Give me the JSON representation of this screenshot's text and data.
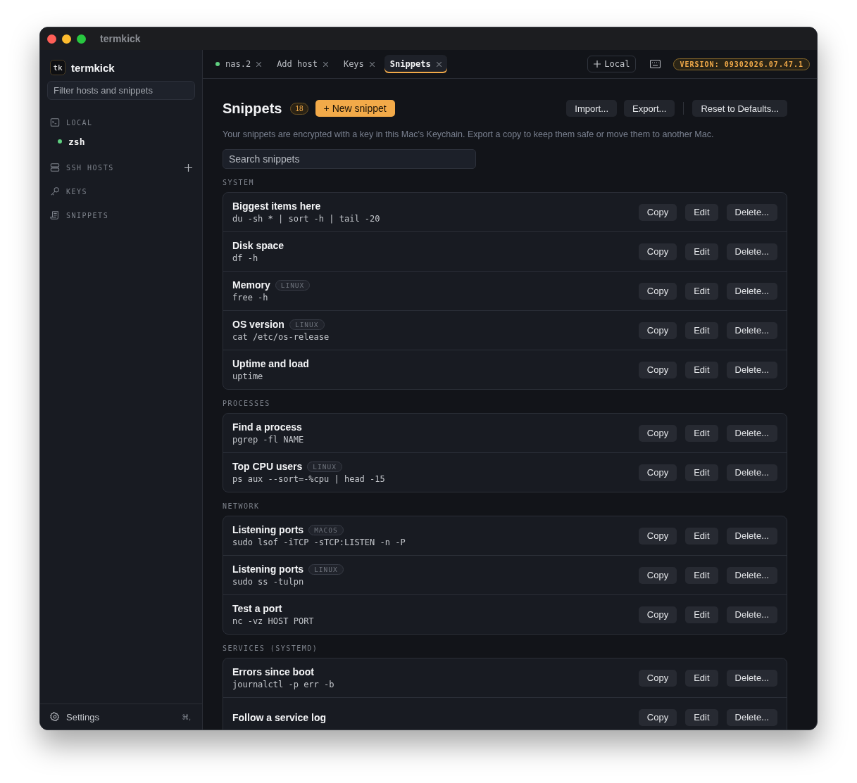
{
  "window": {
    "title": "termkick"
  },
  "sidebar": {
    "logo": "tk",
    "app_name": "termkick",
    "filter": {
      "placeholder": "Filter hosts and snippets"
    },
    "sections": [
      {
        "kind": "terminal",
        "label": "LOCAL",
        "add": false,
        "items": [
          {
            "label": "zsh",
            "color": "#5fcf80"
          }
        ]
      },
      {
        "kind": "server",
        "label": "SSH HOSTS",
        "add": true
      },
      {
        "kind": "key",
        "label": "KEYS",
        "add": false
      },
      {
        "kind": "scroll",
        "label": "SNIPPETS",
        "add": false
      }
    ],
    "settings": {
      "label": "Settings",
      "shortcut": "⌘,"
    }
  },
  "tabs": [
    {
      "label": "nas.2",
      "dot": true,
      "selected": false
    },
    {
      "label": "Add host",
      "dot": false,
      "selected": false
    },
    {
      "label": "Keys",
      "dot": false,
      "selected": false
    },
    {
      "label": "Snippets",
      "dot": false,
      "selected": true
    }
  ],
  "toolbar": {
    "local_button": "Local",
    "version": "VERSION: 09302026.07.47.1"
  },
  "page": {
    "title": "Snippets",
    "count": "18",
    "new_button": "+ New snippet",
    "actions": [
      "Import...",
      "Export...",
      "Reset to Defaults..."
    ],
    "description": "Your snippets are encrypted with a key in this Mac's Keychain. Export a copy to keep them safe or move them to another Mac.",
    "search": {
      "placeholder": "Search snippets"
    },
    "groups": [
      {
        "label": "SYSTEM",
        "snippets": [
          {
            "title": "Biggest items here",
            "command": "du -sh * | sort -h | tail -20",
            "buttons": [
              "Copy",
              "Edit",
              "Delete..."
            ]
          },
          {
            "title": "Disk space",
            "command": "df -h",
            "buttons": [
              "Copy",
              "Edit",
              "Delete..."
            ]
          },
          {
            "title": "Memory",
            "tag": "LINUX",
            "command": "free -h",
            "buttons": [
              "Copy",
              "Edit",
              "Delete..."
            ]
          },
          {
            "title": "OS version",
            "tag": "LINUX",
            "command": "cat /etc/os-release",
            "buttons": [
              "Copy",
              "Edit",
              "Delete..."
            ]
          },
          {
            "title": "Uptime and load",
            "command": "uptime",
            "buttons": [
              "Copy",
              "Edit",
              "Delete..."
            ]
          }
        ]
      },
      {
        "label": "PROCESSES",
        "snippets": [
          {
            "title": "Find a process",
            "command": "pgrep -fl NAME",
            "buttons": [
              "Copy",
              "Edit",
              "Delete..."
            ]
          },
          {
            "title": "Top CPU users",
            "tag": "LINUX",
            "command": "ps aux --sort=-%cpu | head -15",
            "buttons": [
              "Copy",
              "Edit",
              "Delete..."
            ]
          }
        ]
      },
      {
        "label": "NETWORK",
        "snippets": [
          {
            "title": "Listening ports",
            "tag": "MACOS",
            "command": "sudo lsof -iTCP -sTCP:LISTEN -n -P",
            "buttons": [
              "Copy",
              "Edit",
              "Delete..."
            ]
          },
          {
            "title": "Listening ports",
            "tag": "LINUX",
            "command": "sudo ss -tulpn",
            "buttons": [
              "Copy",
              "Edit",
              "Delete..."
            ]
          },
          {
            "title": "Test a port",
            "command": "nc -vz HOST PORT",
            "buttons": [
              "Copy",
              "Edit",
              "Delete..."
            ]
          }
        ]
      },
      {
        "label": "SERVICES (SYSTEMD)",
        "snippets": [
          {
            "title": "Errors since boot",
            "command": "journalctl -p err -b",
            "buttons": [
              "Copy",
              "Edit",
              "Delete..."
            ]
          },
          {
            "title": "Follow a service log",
            "buttons": [
              "Copy",
              "Edit",
              "Delete..."
            ]
          }
        ]
      }
    ]
  }
}
